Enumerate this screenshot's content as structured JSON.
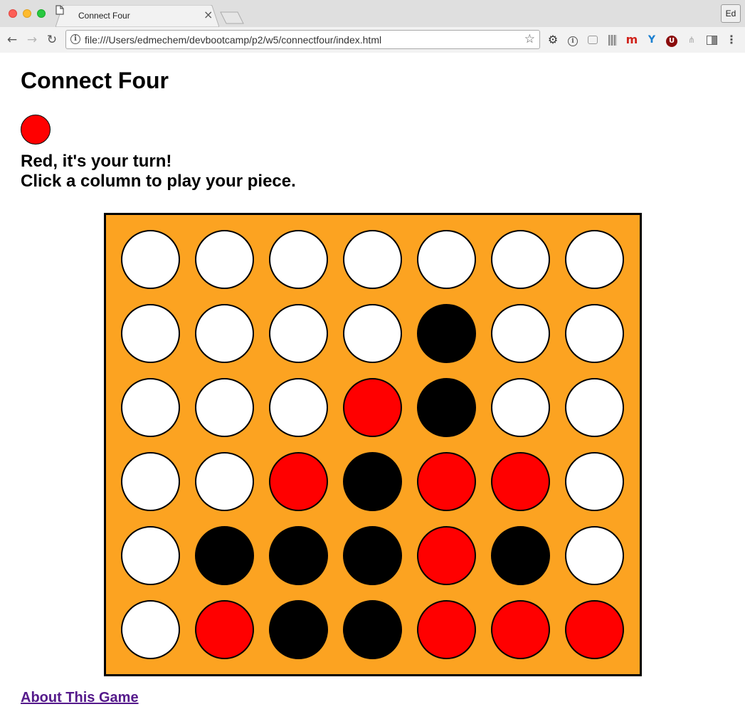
{
  "browser": {
    "tab_title": "Connect Four",
    "tab_close": "×",
    "url": "file:///Users/edmechem/devbootcamp/p2/w5/connectfour/index.html",
    "profile": "Ed",
    "nav": {
      "back": "←",
      "forward": "→",
      "reload": "↻"
    },
    "star": "☆",
    "extensions": [
      "gear-icon",
      "info-circle-icon",
      "screen-icon",
      "barcode-icon",
      "m-logo-icon",
      "y-logo-icon",
      "u-badge-icon",
      "sitemap-icon",
      "sidebar-icon",
      "more-menu-icon"
    ]
  },
  "page": {
    "title": "Connect Four",
    "current_player_color": "#ff0000",
    "message_line1": "Red, it's your turn!",
    "message_line2": "Click a column to play your piece.",
    "about_link": "About This Game"
  },
  "board": {
    "columns": 7,
    "rows": 6,
    "colors": {
      "board": "#fca321",
      "empty": "#ffffff",
      "red": "#ff0000",
      "black": "#000000"
    },
    "grid": [
      [
        "empty",
        "empty",
        "empty",
        "empty",
        "empty",
        "empty",
        "empty"
      ],
      [
        "empty",
        "empty",
        "empty",
        "empty",
        "black",
        "empty",
        "empty"
      ],
      [
        "empty",
        "empty",
        "empty",
        "red",
        "black",
        "empty",
        "empty"
      ],
      [
        "empty",
        "empty",
        "red",
        "black",
        "red",
        "red",
        "empty"
      ],
      [
        "empty",
        "black",
        "black",
        "black",
        "red",
        "black",
        "empty"
      ],
      [
        "empty",
        "red",
        "black",
        "black",
        "red",
        "red",
        "red"
      ]
    ]
  }
}
